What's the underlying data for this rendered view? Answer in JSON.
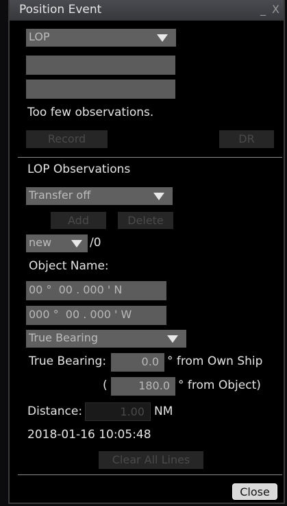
{
  "window": {
    "title": "Position Event",
    "controls": "_ X"
  },
  "top": {
    "mode_select": "LOP",
    "field1": "",
    "field2": "",
    "message": "Too few observations.",
    "record_label": "Record",
    "dr_label": "DR"
  },
  "lop": {
    "section_title": "LOP Observations",
    "transfer_select": "Transfer off",
    "add_label": "Add",
    "delete_label": "Delete",
    "obs_select": "new",
    "obs_count": "/0",
    "object_name_label": "Object Name:",
    "lat": "00 °  00 . 000 ' N",
    "lon": "000 °  00 . 000 ' W",
    "bearing_type_select": "True Bearing",
    "true_bearing_label": "True Bearing:",
    "true_bearing_value": "0.0",
    "from_own_ship": "° from Own Ship",
    "paren_open": "(",
    "reverse_bearing_value": "180.0",
    "from_object": "° from Object)",
    "distance_label": "Distance:",
    "distance_value": "1.00",
    "distance_unit": "NM",
    "timestamp": "2018-01-16 10:05:48",
    "clear_label": "Clear All Lines"
  },
  "footer": {
    "close_label": "Close"
  }
}
